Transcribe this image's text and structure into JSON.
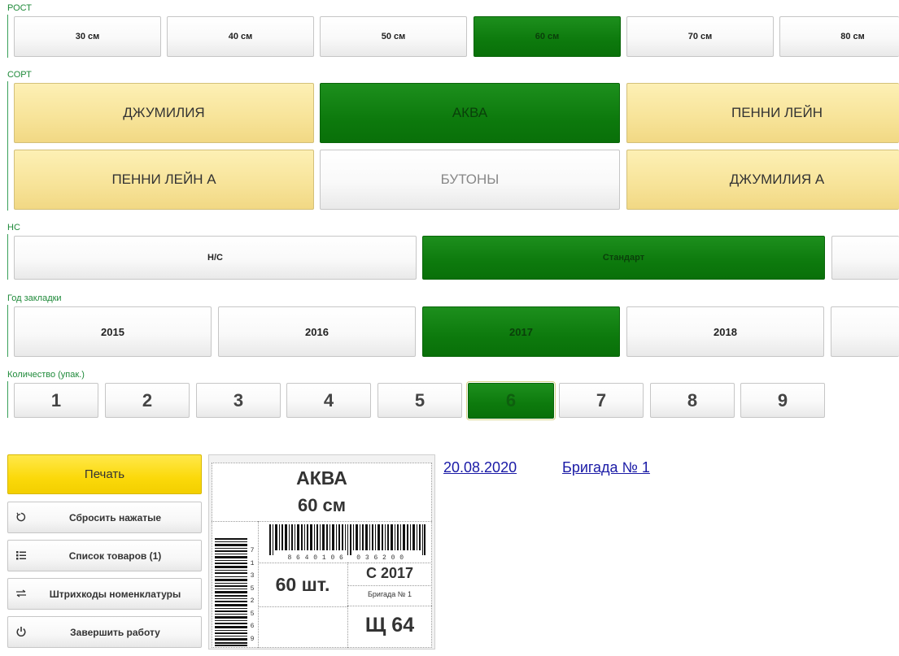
{
  "height_section": {
    "label": "РОСТ",
    "options": [
      "30 см",
      "40 см",
      "50 см",
      "60 см",
      "70 см",
      "80 см"
    ],
    "selected": "60 см"
  },
  "variety_section": {
    "label": "СОРТ",
    "options": [
      "ДЖУМИЛИЯ",
      "АКВА",
      "ПЕННИ ЛЕЙН",
      "ПЕННИ ЛЕЙН А",
      "БУТОНЫ",
      "ДЖУМИЛИЯ А"
    ],
    "selected": "АКВА"
  },
  "ns_section": {
    "label": "НС",
    "options": [
      "Н/С",
      "Стандарт",
      ""
    ],
    "selected": "Стандарт"
  },
  "year_section": {
    "label": "Год закладки",
    "options": [
      "2015",
      "2016",
      "2017",
      "2018",
      ""
    ],
    "selected": "2017"
  },
  "quantity_section": {
    "label": "Количество (упак.)",
    "options": [
      "1",
      "2",
      "3",
      "4",
      "5",
      "6",
      "7",
      "8",
      "9"
    ],
    "selected": "6"
  },
  "actions": {
    "print": "Печать",
    "reset": "Сбросить нажатые",
    "products_list": "Список товаров (1)",
    "barcodes": "Штрихкоды номенклатуры",
    "finish": "Завершить работу"
  },
  "icons": {
    "reset": "reset-icon",
    "products_list": "list-icon",
    "barcodes": "barcode-arrows-icon",
    "finish": "power-icon"
  },
  "label_preview": {
    "variety": "АКВА",
    "height": "60 см",
    "barcode_digits": "8 6 4 0 1 0 6   0 3 6 2 0 0",
    "vertical_barcode_digits": "7 1 3 5 2 5 6 9",
    "count": "60 шт.",
    "year": "С 2017",
    "brigade": "Бригада № 1",
    "code": "Щ 64"
  },
  "header_links": {
    "date": "20.08.2020",
    "brigade": "Бригада № 1"
  },
  "colors": {
    "selected_green": "#0d7a0d",
    "variety_yellow": "#f7e398",
    "print_yellow": "#fbd90a",
    "section_label": "#1f8a3a",
    "link": "#1a1aa6"
  }
}
